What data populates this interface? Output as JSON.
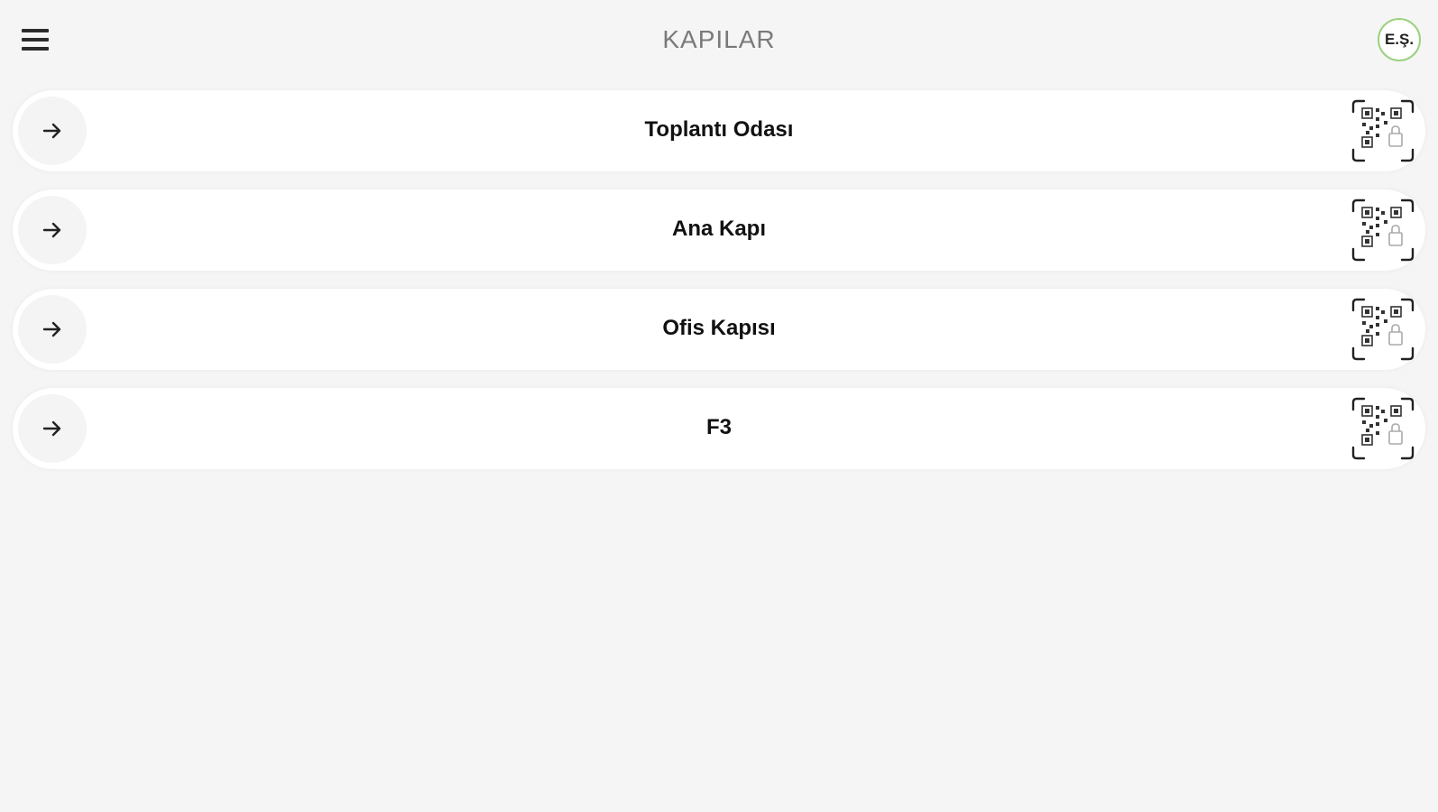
{
  "header": {
    "title": "KAPILAR",
    "menu_icon": "hamburger-menu-icon",
    "avatar_initials": "E.Ş."
  },
  "doors": [
    {
      "name": "Toplantı Odası"
    },
    {
      "name": "Ana Kapı"
    },
    {
      "name": "Ofis Kapısı"
    },
    {
      "name": "F3"
    }
  ],
  "icons": {
    "row_leading": "arrow-right-icon",
    "row_trailing": "qr-lock-icon"
  },
  "colors": {
    "background": "#f5f5f5",
    "card": "#ffffff",
    "title": "#7a7a7a",
    "avatar_border": "#9ad27f"
  }
}
